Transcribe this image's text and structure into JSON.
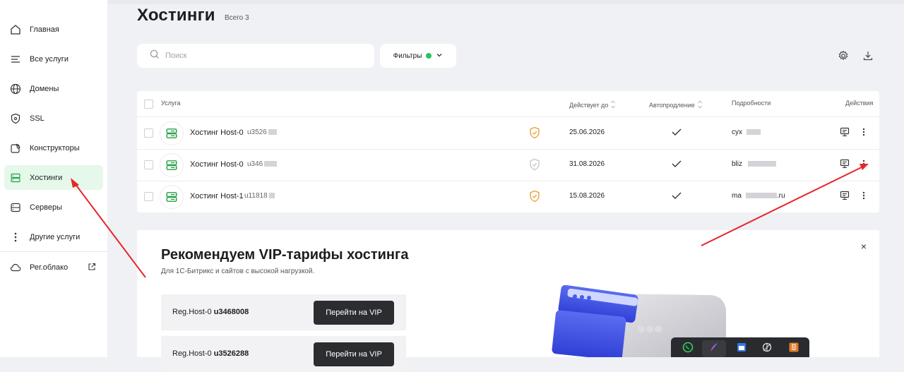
{
  "sidebar": {
    "items": [
      {
        "label": "Главная",
        "icon": "home-icon"
      },
      {
        "label": "Все услуги",
        "icon": "list-icon"
      },
      {
        "label": "Домены",
        "icon": "globe-icon"
      },
      {
        "label": "SSL",
        "icon": "shield-icon"
      },
      {
        "label": "Конструкторы",
        "icon": "constructor-icon"
      },
      {
        "label": "Хостинги",
        "icon": "hosting-icon",
        "active": true
      },
      {
        "label": "Серверы",
        "icon": "server-icon"
      },
      {
        "label": "Другие услуги",
        "icon": "dots-icon"
      },
      {
        "label": "Рег.облако",
        "icon": "cloud-icon"
      }
    ]
  },
  "header": {
    "title": "Хостинги",
    "total": "Всего 3"
  },
  "search": {
    "placeholder": "Поиск"
  },
  "filters": {
    "label": "Фильтры",
    "active_color": "#26c35a"
  },
  "table": {
    "columns": {
      "service": "Услуга",
      "valid_until": "Действует до",
      "autorenew": "Автопродление",
      "details": "Подробности",
      "actions": "Действия"
    },
    "rows": [
      {
        "name": "Хостинг Host-0",
        "id": "u3526",
        "ssl": "active",
        "date": "25.06.2026",
        "autorenew": true,
        "detail": "cyx"
      },
      {
        "name": "Хостинг Host-0",
        "id": "u346",
        "ssl": "inactive",
        "date": "31.08.2026",
        "autorenew": true,
        "detail": "bliz"
      },
      {
        "name": "Хостинг Host-1",
        "id": "u11818",
        "ssl": "active",
        "date": "15.08.2026",
        "autorenew": true,
        "detail": "ma",
        "detail_tail": ".ru"
      }
    ]
  },
  "promo": {
    "title": "Рекомендуем VIP-тарифы хостинга",
    "subtitle": "Для 1С-Битрикс и сайтов с высокой нагрузкой.",
    "close": "×",
    "offers": [
      {
        "plan": "Reg.Host-0",
        "id": "u3468008",
        "button": "Перейти на VIP"
      },
      {
        "plan": "Reg.Host-0",
        "id": "u3526288",
        "button": "Перейти на VIP"
      }
    ]
  },
  "colors": {
    "accent": "#26c35a",
    "ssl_active": "#e8a33a",
    "annotation": "#e8252b"
  }
}
